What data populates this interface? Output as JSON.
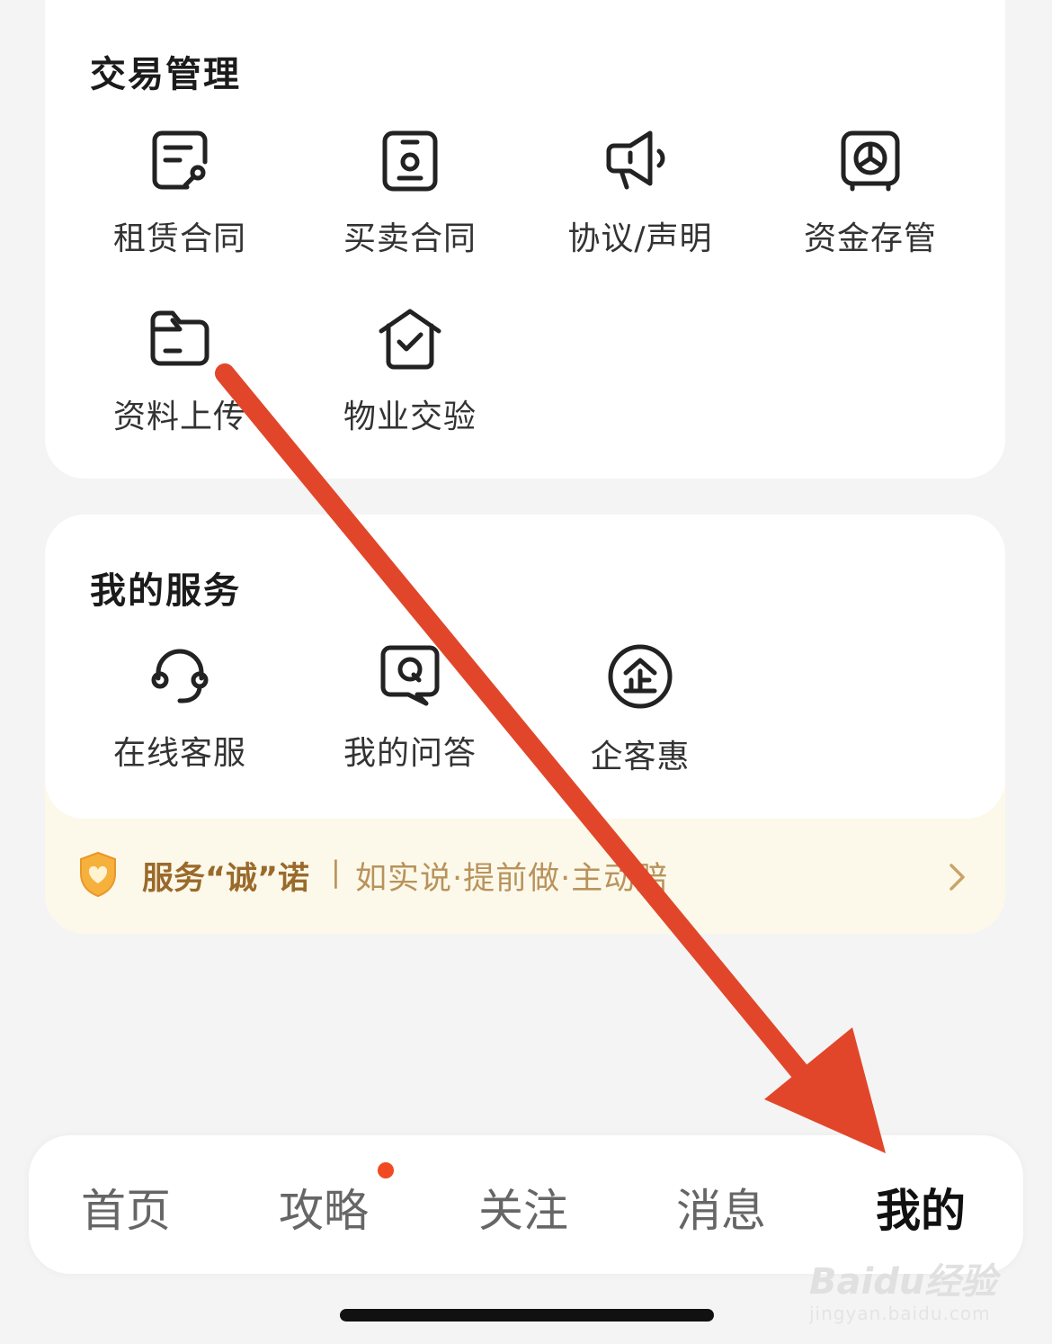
{
  "trade_section": {
    "title": "交易管理",
    "items": [
      {
        "label": "租赁合同",
        "icon": "contract-sign-icon"
      },
      {
        "label": "买卖合同",
        "icon": "purchase-contract-icon"
      },
      {
        "label": "协议/声明",
        "icon": "megaphone-icon"
      },
      {
        "label": "资金存管",
        "icon": "safe-icon"
      },
      {
        "label": "资料上传",
        "icon": "folder-upload-icon"
      },
      {
        "label": "物业交验",
        "icon": "house-check-icon"
      }
    ]
  },
  "service_section": {
    "title": "我的服务",
    "items": [
      {
        "label": "在线客服",
        "icon": "headset-icon"
      },
      {
        "label": "我的问答",
        "icon": "qa-bubble-icon"
      },
      {
        "label": "企客惠",
        "icon": "enterprise-icon"
      }
    ]
  },
  "pledge": {
    "title": "服务“诚”诺",
    "separator": "|",
    "subtitle": "如实说·提前做·主动赔"
  },
  "tabbar": {
    "tabs": [
      {
        "label": "首页",
        "active": false
      },
      {
        "label": "攻略",
        "active": false,
        "badge_dot": true
      },
      {
        "label": "关注",
        "active": false
      },
      {
        "label": "消息",
        "active": false
      },
      {
        "label": "我的",
        "active": true
      }
    ]
  },
  "watermark": {
    "main": "Baidu经验",
    "sub": "jingyan.baidu.com"
  },
  "colors": {
    "accent_dot": "#f04a23",
    "arrow": "#e2462a",
    "pledge_text": "#9a6a2b",
    "pledge_bg": "#fdf9ea"
  }
}
